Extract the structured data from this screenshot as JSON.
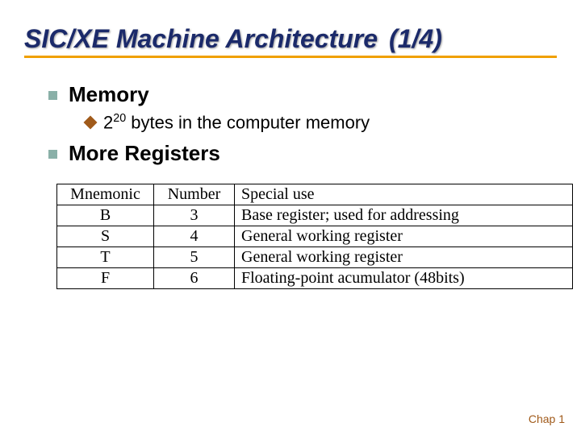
{
  "title": {
    "main": "SIC/XE Machine Architecture",
    "page_indicator": "(1/4)"
  },
  "bullets": {
    "memory": {
      "label": "Memory",
      "sub_prefix": "2",
      "sub_sup": "20",
      "sub_rest": " bytes in the computer memory"
    },
    "registers": {
      "label": "More Registers"
    }
  },
  "table": {
    "headers": {
      "mnemonic": "Mnemonic",
      "number": "Number",
      "special": "Special use"
    },
    "rows": [
      {
        "mnemonic": "B",
        "number": "3",
        "special": "Base register; used for addressing"
      },
      {
        "mnemonic": "S",
        "number": "4",
        "special": "General working register"
      },
      {
        "mnemonic": "T",
        "number": "5",
        "special": "General working register"
      },
      {
        "mnemonic": "F",
        "number": "6",
        "special": "Floating-point acumulator (48bits)"
      }
    ]
  },
  "footer": "Chap 1"
}
